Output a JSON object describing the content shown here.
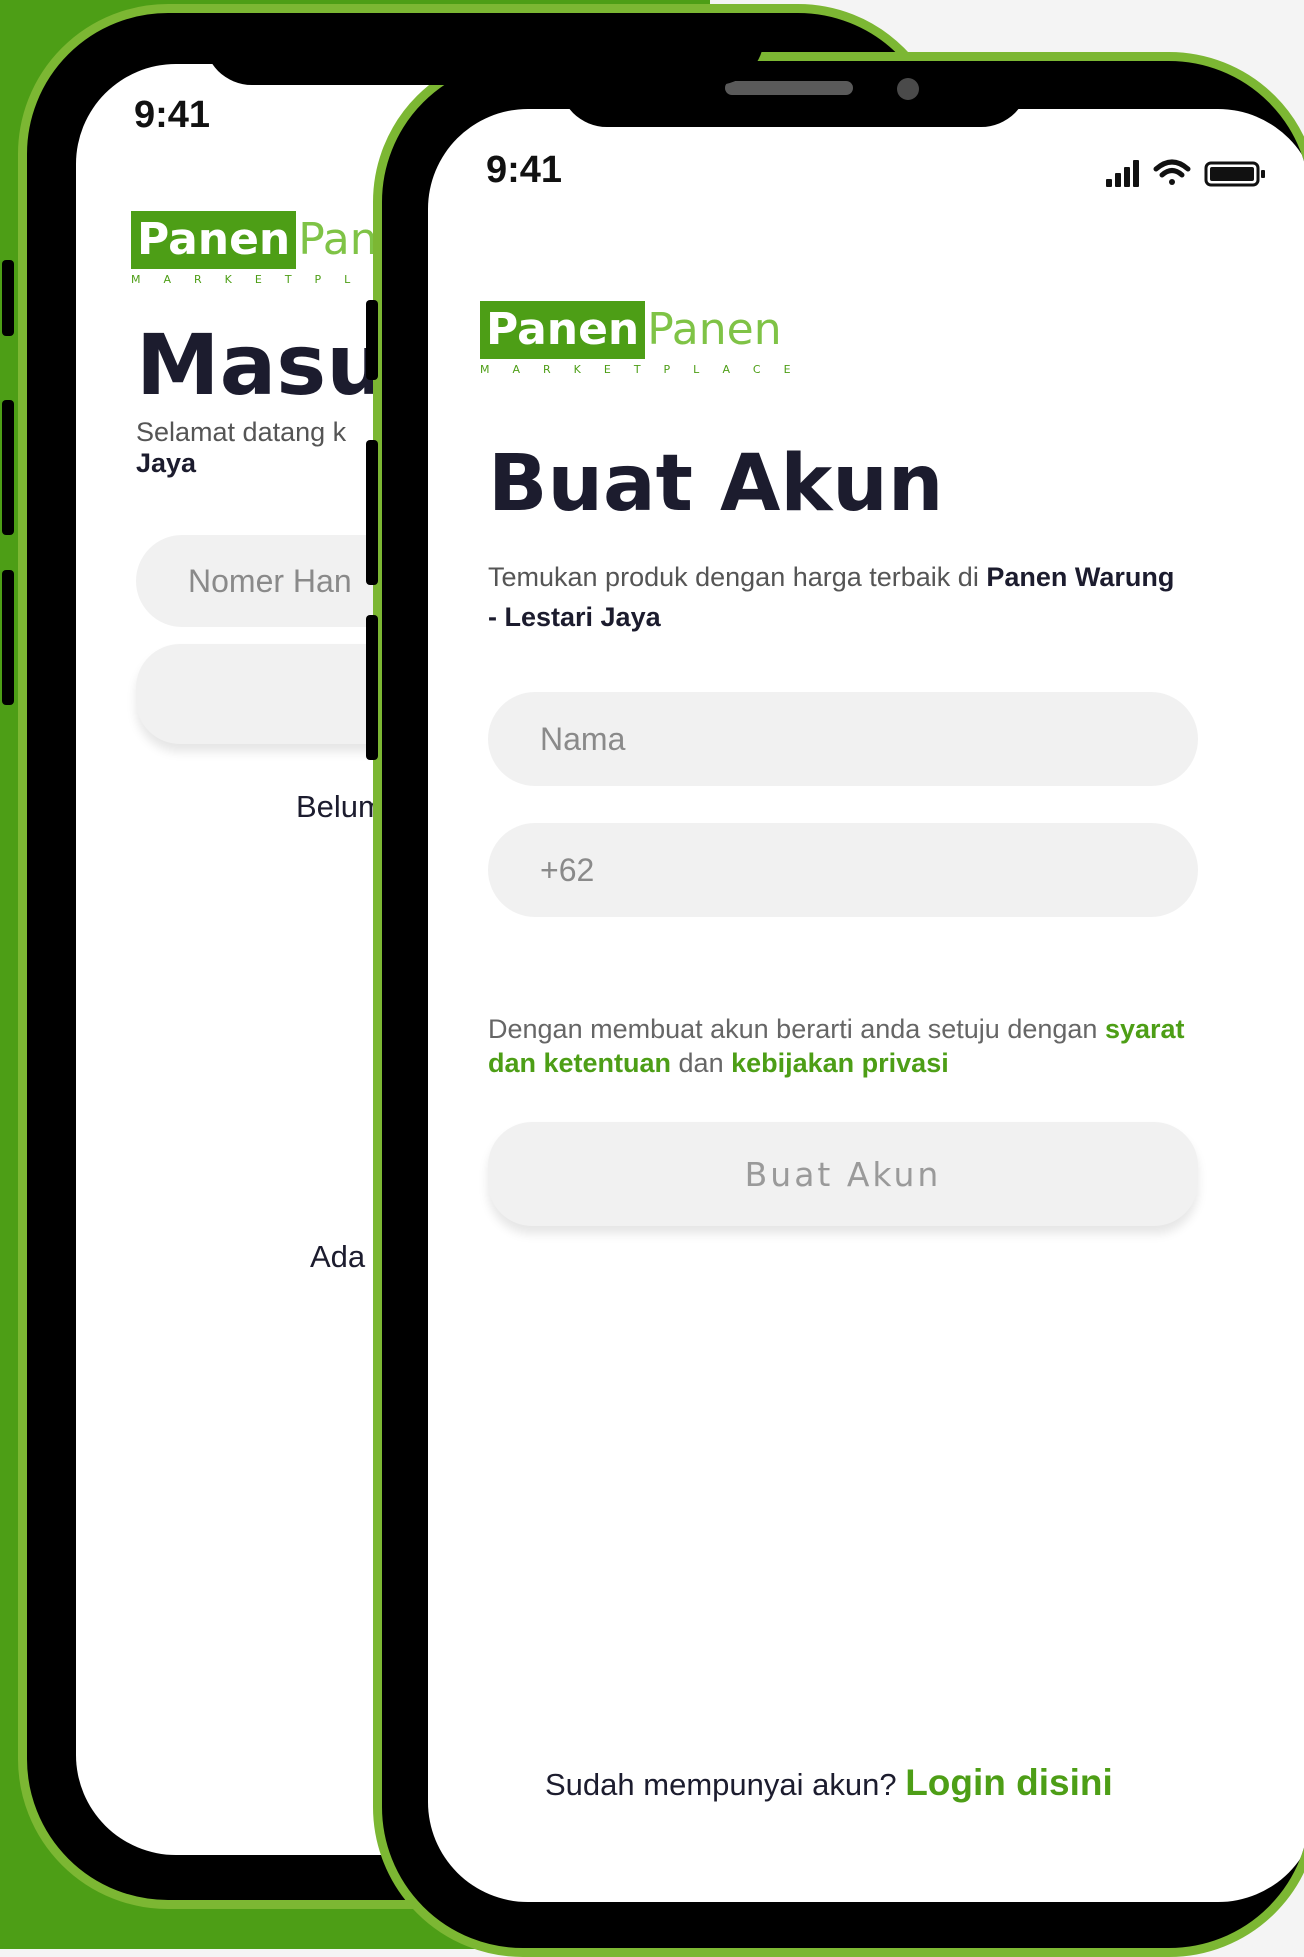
{
  "back_screen": {
    "status_time": "9:41",
    "logo": {
      "part1": "Panen",
      "part2": "Panen",
      "tagline": "MARKETPLACE"
    },
    "title": "Masu",
    "subtitle_prefix": "Selamat datang k",
    "subtitle_bold": "Jaya",
    "phone_placeholder": "Nomer Han",
    "register_prompt": "Belum",
    "help_text": "Ada k"
  },
  "front_screen": {
    "status_time": "9:41",
    "logo": {
      "part1": "Panen",
      "part2": "Panen",
      "tagline": "MARKETPLACE"
    },
    "title": "Buat Akun",
    "subtitle": "Temukan produk dengan harga terbaik di ",
    "subtitle_bold": "Panen Warung - Lestari Jaya",
    "name_placeholder": "Nama",
    "phone_placeholder": "+62",
    "terms_prefix": "Dengan membuat akun berarti anda setuju dengan ",
    "terms_link": "syarat dan ketentuan",
    "terms_middle": " dan ",
    "privacy_link": "kebijakan privasi",
    "submit_label": "Buat Akun",
    "footer_prompt": "Sudah mempunyai akun? ",
    "login_link": "Login disini"
  },
  "colors": {
    "brand_green": "#4d9e16",
    "light_green": "#7fc346",
    "bezel_green": "#7cb733"
  }
}
